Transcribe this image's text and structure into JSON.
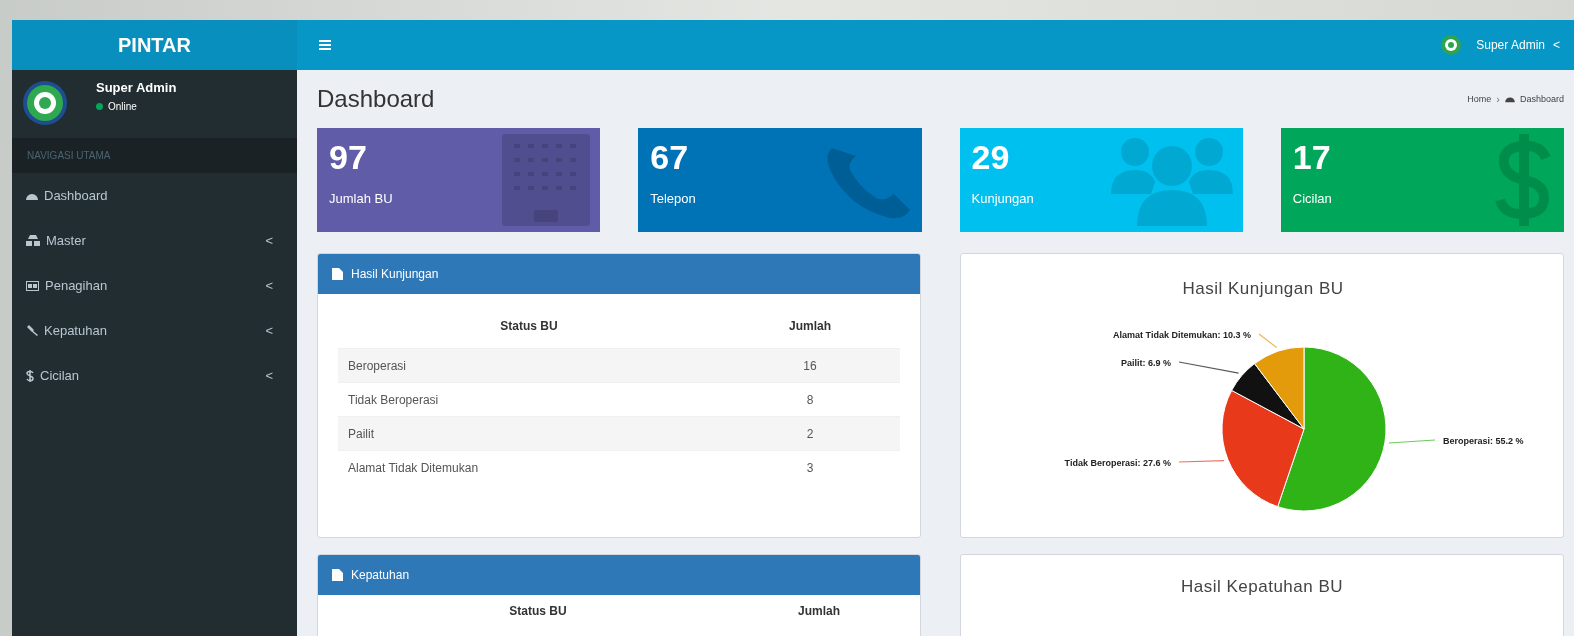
{
  "brand": "PINTAR",
  "topbar": {
    "user": "Super Admin",
    "caret": "<"
  },
  "sidebar": {
    "user": "Super Admin",
    "status": "Online",
    "header": "NAVIGASI UTAMA",
    "items": [
      {
        "kind": "dashboard",
        "label": "Dashboard",
        "selected": false
      },
      {
        "kind": "master",
        "label": "Master",
        "selected": false,
        "caret": "<"
      },
      {
        "kind": "penagihan",
        "label": "Penagihan",
        "selected": false,
        "caret": "<"
      },
      {
        "kind": "kepatuhan",
        "label": "Kepatuhan",
        "selected": false,
        "caret": "<"
      },
      {
        "kind": "cicilan",
        "label": "Cicilan",
        "selected": false,
        "caret": "<"
      }
    ]
  },
  "page": {
    "title": "Dashboard",
    "breadcrumb": [
      "Home",
      "Dashboard"
    ],
    "breadcrumb_separator": "›"
  },
  "stats": [
    {
      "value": "97",
      "label": "Jumlah BU",
      "color": "#605ca8",
      "kind": "building"
    },
    {
      "value": "67",
      "label": "Telepon",
      "color": "#0073b7",
      "kind": "phone"
    },
    {
      "value": "29",
      "label": "Kunjungan",
      "color": "#00c0ef",
      "kind": "users"
    },
    {
      "value": "17",
      "label": "Cicilan",
      "color": "#00a65a",
      "kind": "dollar"
    }
  ],
  "panels": [
    {
      "title": "Hasil Kunjungan",
      "columns": [
        "Status BU",
        "Jumlah"
      ],
      "rows": [
        [
          "Beroperasi",
          "16"
        ],
        [
          "Tidak Beroperasi",
          "8"
        ],
        [
          "Pailit",
          "2"
        ],
        [
          "Alamat Tidak Ditemukan",
          "3"
        ]
      ]
    },
    {
      "title": "Kepatuhan",
      "columns": [
        "Status BU",
        "Jumlah"
      ]
    }
  ],
  "charts": [
    {
      "chart_data": {
        "type": "pie",
        "title": "Hasil Kunjungan BU",
        "series": [
          {
            "values": [
              55.2,
              27.6,
              6.9,
              10.3
            ]
          }
        ],
        "colors": [
          "#2fb317",
          "#e8391b",
          "#111111",
          "#e39b0c"
        ],
        "value_labels": [
          "Beroperasi: 55.2 %",
          "Tidak Beroperasi: 27.6 %",
          "Pailit: 6.9 %",
          "Alamat Tidak Ditemukan: 10.3 %"
        ]
      }
    },
    {
      "title": "Hasil Kepatuhan BU"
    }
  ]
}
